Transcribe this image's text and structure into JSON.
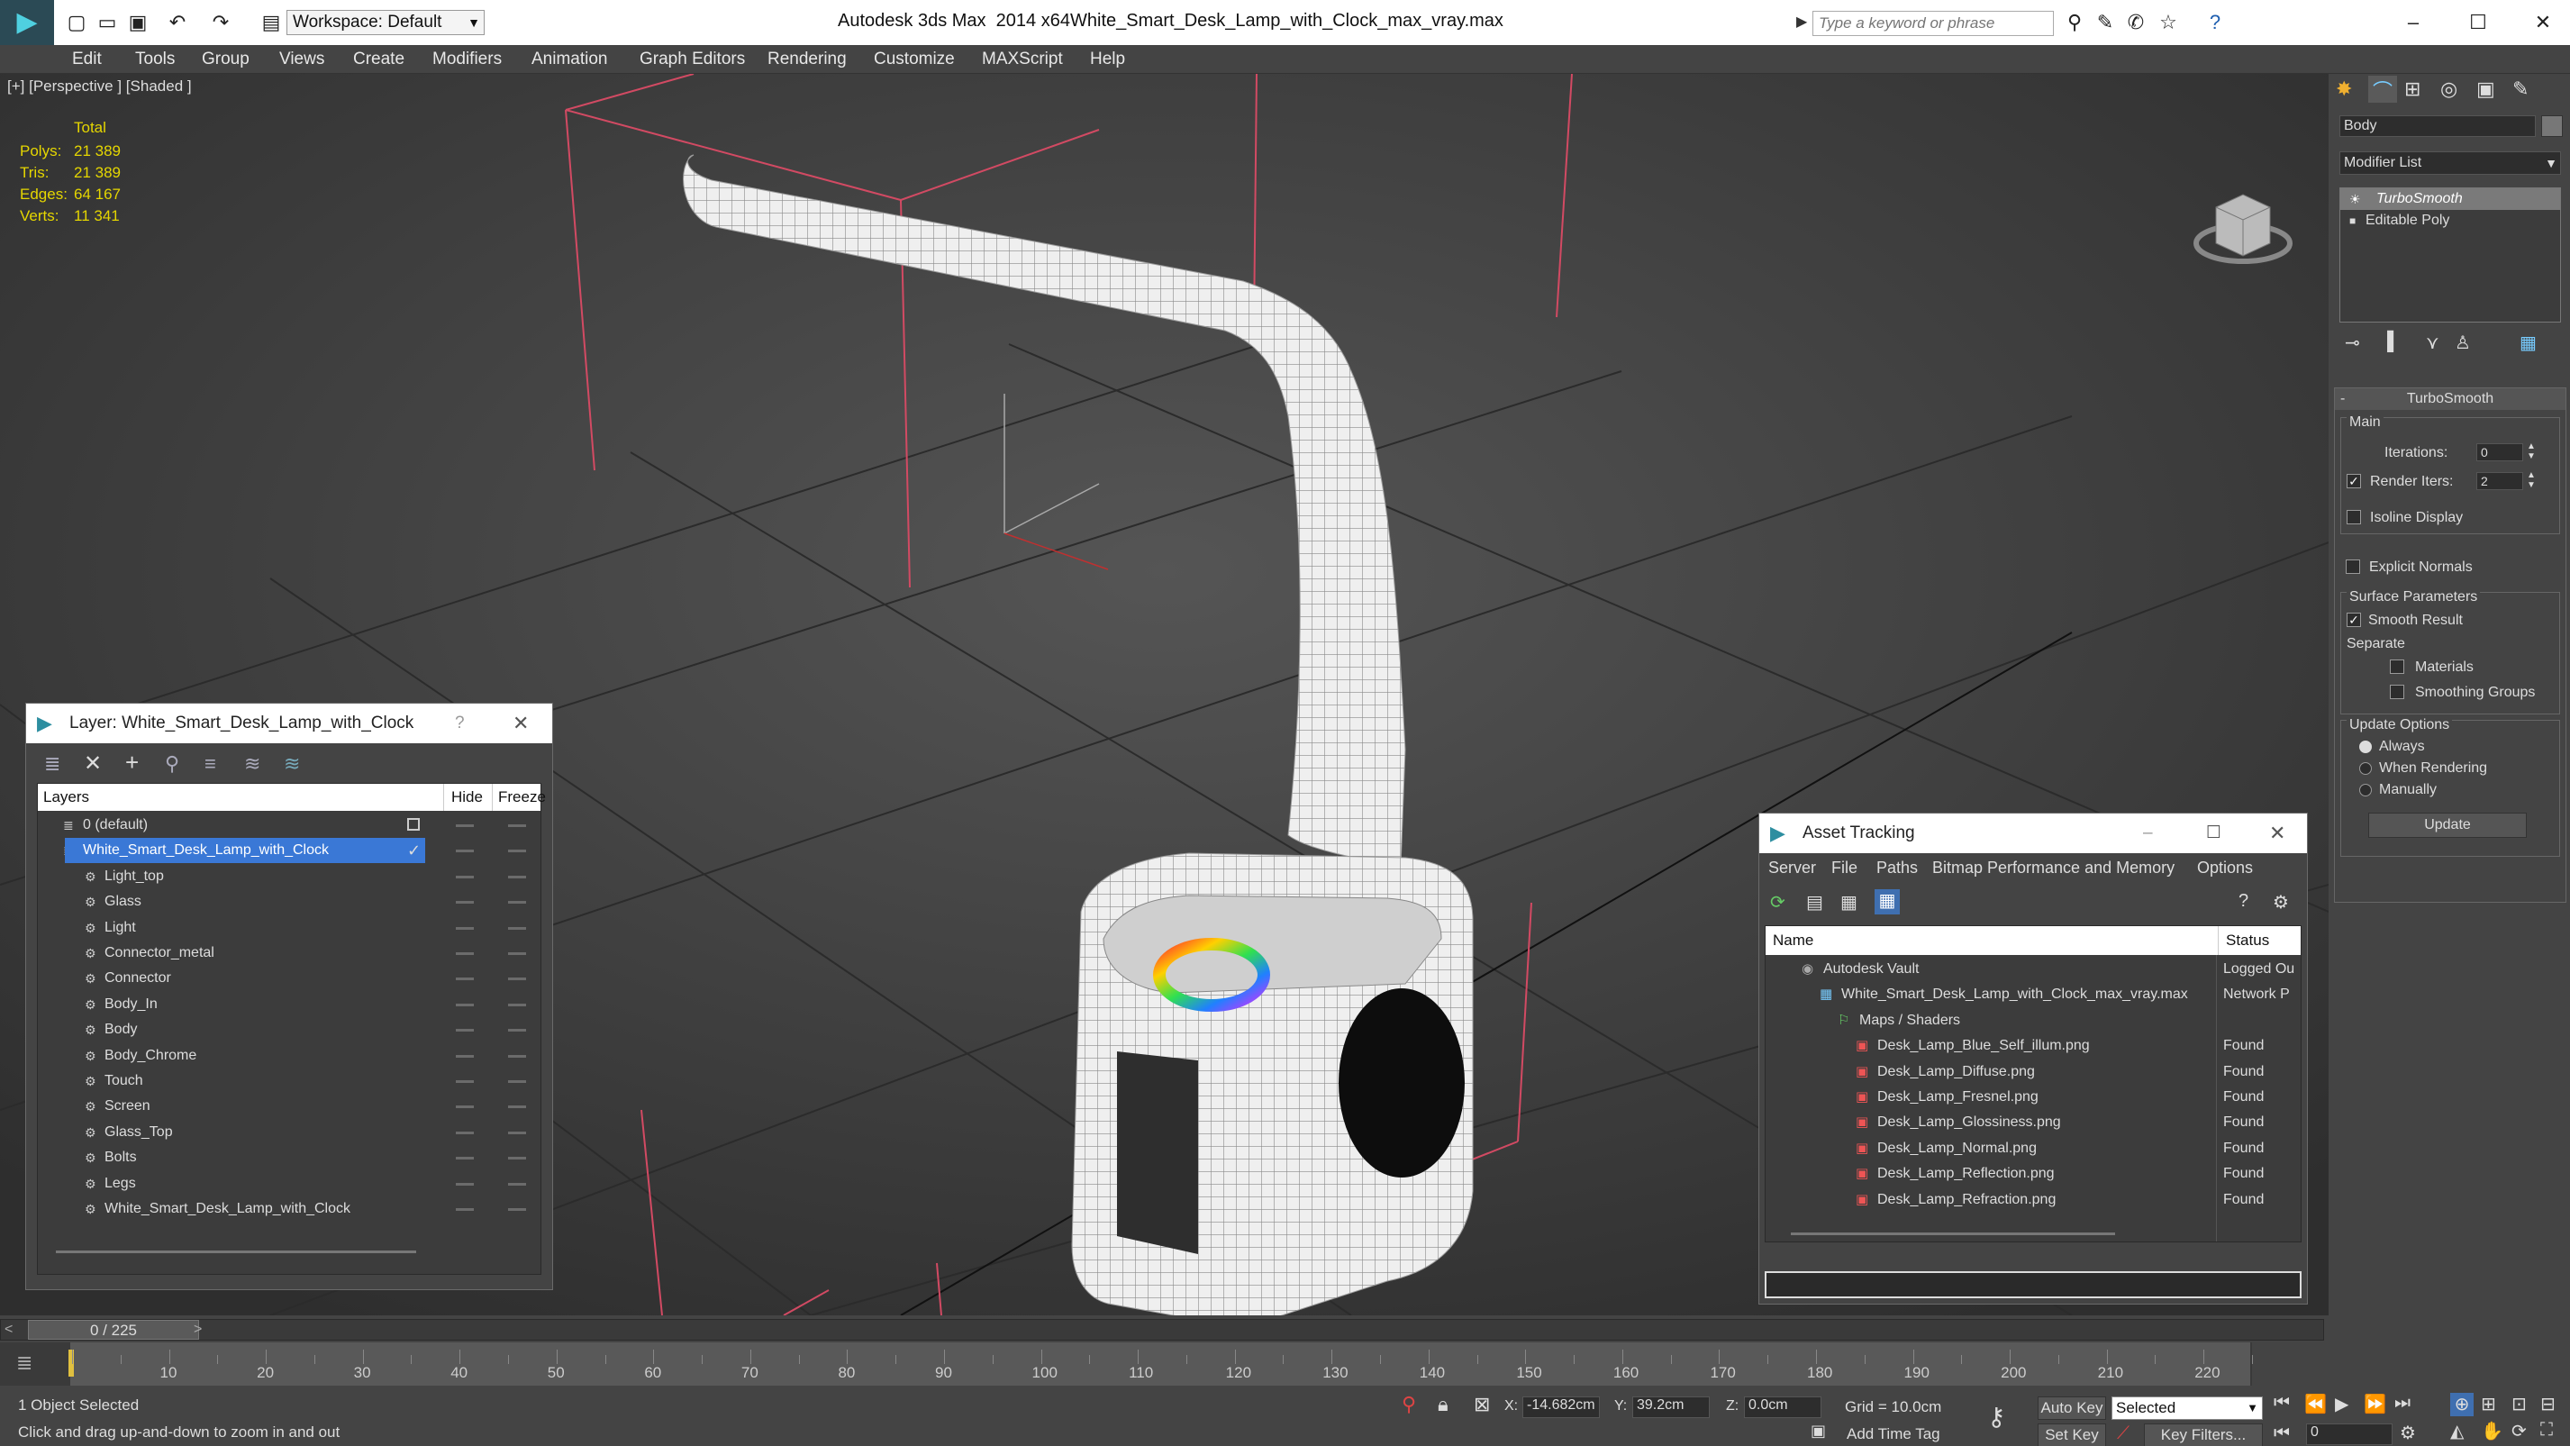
{
  "window": {
    "app_title": "Autodesk 3ds Max  2014 x64",
    "file_title": "White_Smart_Desk_Lamp_with_Clock_max_vray.max",
    "workspace": "Workspace: Default",
    "search_placeholder": "Type a keyword or phrase"
  },
  "menu": [
    "Edit",
    "Tools",
    "Group",
    "Views",
    "Create",
    "Modifiers",
    "Animation",
    "Graph Editors",
    "Rendering",
    "Customize",
    "MAXScript",
    "Help"
  ],
  "viewport": {
    "label": "[+] [Perspective ] [Shaded ]",
    "stats_header": "Total",
    "stats": [
      {
        "label": "Polys:",
        "value": "21 389"
      },
      {
        "label": "Tris:",
        "value": "21 389"
      },
      {
        "label": "Edges:",
        "value": "64 167"
      },
      {
        "label": "Verts:",
        "value": "11 341"
      }
    ]
  },
  "layer_dialog": {
    "title": "Layer: White_Smart_Desk_Lamp_with_Clock",
    "help": "?",
    "col_layers": "Layers",
    "col_hide": "Hide",
    "col_freeze": "Freeze",
    "rows": [
      {
        "name": "0 (default)",
        "level": 0
      },
      {
        "name": "White_Smart_Desk_Lamp_with_Clock",
        "level": 0,
        "selected": true
      },
      {
        "name": "Light_top",
        "level": 1
      },
      {
        "name": "Glass",
        "level": 1
      },
      {
        "name": "Light",
        "level": 1
      },
      {
        "name": "Connector_metal",
        "level": 1
      },
      {
        "name": "Connector",
        "level": 1
      },
      {
        "name": "Body_In",
        "level": 1
      },
      {
        "name": "Body",
        "level": 1
      },
      {
        "name": "Body_Chrome",
        "level": 1
      },
      {
        "name": "Touch",
        "level": 1
      },
      {
        "name": "Screen",
        "level": 1
      },
      {
        "name": "Glass_Top",
        "level": 1
      },
      {
        "name": "Bolts",
        "level": 1
      },
      {
        "name": "Legs",
        "level": 1
      },
      {
        "name": "White_Smart_Desk_Lamp_with_Clock",
        "level": 1
      }
    ]
  },
  "asset_dialog": {
    "title": "Asset Tracking",
    "menu": [
      "Server",
      "File",
      "Paths",
      "Bitmap Performance and Memory",
      "Options"
    ],
    "col_name": "Name",
    "col_status": "Status",
    "rows": [
      {
        "name": "Autodesk Vault",
        "status": "Logged Ou",
        "level": 0
      },
      {
        "name": "White_Smart_Desk_Lamp_with_Clock_max_vray.max",
        "status": "Network P",
        "level": 1
      },
      {
        "name": "Maps / Shaders",
        "status": "",
        "level": 2
      },
      {
        "name": "Desk_Lamp_Blue_Self_illum.png",
        "status": "Found",
        "level": 3
      },
      {
        "name": "Desk_Lamp_Diffuse.png",
        "status": "Found",
        "level": 3
      },
      {
        "name": "Desk_Lamp_Fresnel.png",
        "status": "Found",
        "level": 3
      },
      {
        "name": "Desk_Lamp_Glossiness.png",
        "status": "Found",
        "level": 3
      },
      {
        "name": "Desk_Lamp_Normal.png",
        "status": "Found",
        "level": 3
      },
      {
        "name": "Desk_Lamp_Reflection.png",
        "status": "Found",
        "level": 3
      },
      {
        "name": "Desk_Lamp_Refraction.png",
        "status": "Found",
        "level": 3
      }
    ]
  },
  "command_panel": {
    "object_name": "Body",
    "modifier_list": "Modifier List",
    "stack": [
      "TurboSmooth",
      "Editable Poly"
    ],
    "rollout_title": "TurboSmooth",
    "main_group": "Main",
    "iterations_label": "Iterations:",
    "iterations_value": "0",
    "render_iters_label": "Render Iters:",
    "render_iters_value": "2",
    "isoline": "Isoline Display",
    "explicit_normals": "Explicit Normals",
    "surface_group": "Surface Parameters",
    "smooth_result": "Smooth Result",
    "separate": "Separate",
    "materials": "Materials",
    "smoothing_groups": "Smoothing Groups",
    "update_group": "Update Options",
    "always": "Always",
    "when_rendering": "When Rendering",
    "manually": "Manually",
    "update_button": "Update"
  },
  "timeline": {
    "frame_counter": "0 / 225",
    "ticks": [
      "10",
      "20",
      "30",
      "40",
      "50",
      "60",
      "70",
      "80",
      "90",
      "100",
      "110",
      "120",
      "130",
      "140",
      "150",
      "160",
      "170",
      "180",
      "190",
      "200",
      "210",
      "220"
    ],
    "status_selected": "1 Object Selected",
    "prompt": "Click and drag up-and-down to zoom in and out",
    "x_label": "X:",
    "x_value": "-14.682cm",
    "y_label": "Y:",
    "y_value": "39.2cm",
    "z_label": "Z:",
    "z_value": "0.0cm",
    "grid": "Grid = 10.0cm",
    "add_time_tag": "Add Time Tag",
    "auto_key": "Auto Key",
    "set_key": "Set Key",
    "selected_dropdown": "Selected",
    "key_filters": "Key Filters...",
    "frame_value": "0"
  }
}
